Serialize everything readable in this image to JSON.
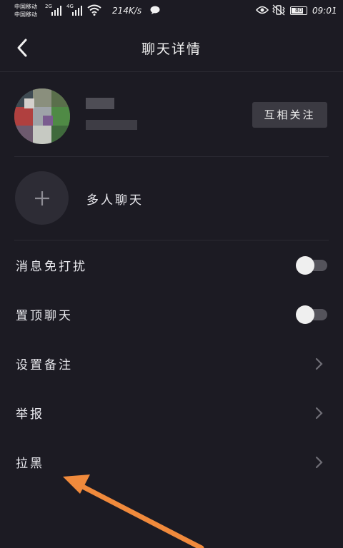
{
  "status_bar": {
    "carrier_1": "中国移动",
    "carrier_2": "中国移动",
    "net_1": "2G",
    "net_2": "4G",
    "speed": "214K/s",
    "battery": "80",
    "battery_level": 0.8,
    "time": "09:01"
  },
  "header": {
    "title": "聊天详情"
  },
  "profile": {
    "follow_button": "互相关注"
  },
  "group_chat": {
    "label": "多人聊天"
  },
  "settings": [
    {
      "label": "消息免打扰",
      "type": "toggle",
      "on": false
    },
    {
      "label": "置顶聊天",
      "type": "toggle",
      "on": false
    },
    {
      "label": "设置备注",
      "type": "link"
    },
    {
      "label": "举报",
      "type": "link"
    },
    {
      "label": "拉黑",
      "type": "link"
    }
  ],
  "colors": {
    "background": "#1c1b23",
    "button_bg": "#3b3a42",
    "annotation_arrow": "#f08a3c"
  }
}
